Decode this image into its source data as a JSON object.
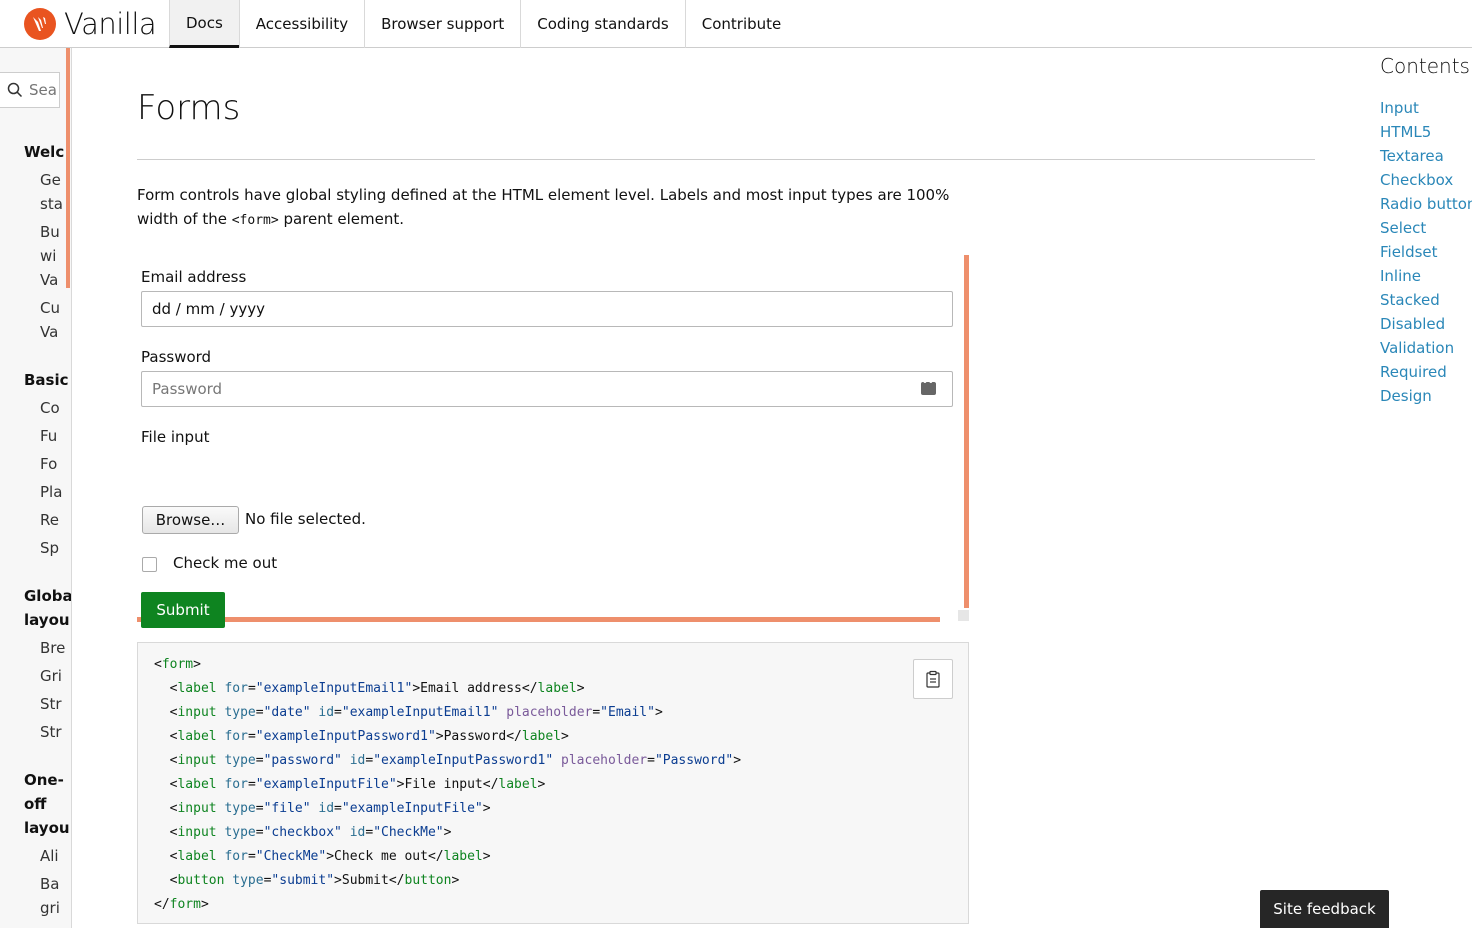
{
  "header": {
    "logo_text": "Vanilla",
    "tabs": [
      {
        "label": "Docs",
        "active": true
      },
      {
        "label": "Accessibility",
        "active": false
      },
      {
        "label": "Browser support",
        "active": false
      },
      {
        "label": "Coding standards",
        "active": false
      },
      {
        "label": "Contribute",
        "active": false
      }
    ]
  },
  "sidebar": {
    "search_placeholder": "Sea",
    "groups": [
      {
        "label": "Welc",
        "items": [
          "Ge",
          "sta",
          "Bu",
          "wi",
          "Va",
          "Cu",
          "Va"
        ]
      },
      {
        "label": "Basic",
        "items": [
          "Co",
          "Fu",
          "Fo",
          "Pla",
          "Re",
          "Sp"
        ]
      },
      {
        "label": "Globa",
        "label2": "layou",
        "items": [
          "Bre",
          "Gri",
          "Str",
          "Str"
        ]
      },
      {
        "label": "One-",
        "label2": "off",
        "label3": "layou",
        "items": [
          "Ali",
          "Ba",
          "gri"
        ]
      }
    ]
  },
  "main": {
    "title": "Forms",
    "intro_before": "Form controls have global styling defined at the HTML element level. Labels and most input types are 100% width of the ",
    "intro_code": "<form>",
    "intro_after": " parent element.",
    "form": {
      "email_label": "Email address",
      "email_value": "dd / mm / yyyy",
      "password_label": "Password",
      "password_placeholder": "Password",
      "file_label": "File input",
      "browse_label": "Browse…",
      "file_status": "No file selected.",
      "check_label": "Check me out",
      "submit_label": "Submit"
    }
  },
  "toc": {
    "title": "Contents",
    "links": [
      "Input",
      "HTML5",
      "Textarea",
      "Checkbox",
      "Radio button",
      "Select",
      "Fieldset",
      "Inline",
      "Stacked",
      "Disabled",
      "Validation",
      "Required",
      "Design"
    ]
  },
  "feedback_label": "Site feedback",
  "colors": {
    "brand": "#e95420",
    "accent": "#ee8f6c",
    "submit": "#0e8420",
    "link": "#2a87b8"
  }
}
